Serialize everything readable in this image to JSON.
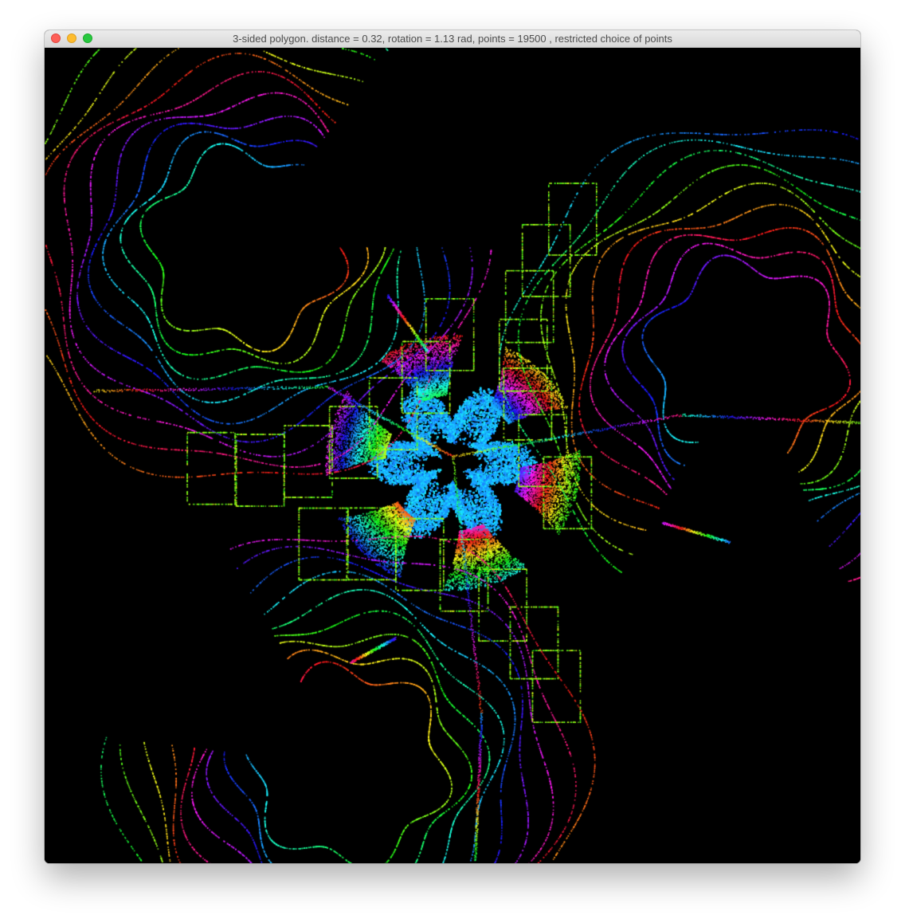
{
  "window": {
    "title": "3-sided polygon. distance = 0.32, rotation = 1.13 rad, points = 19500 , restricted choice of points",
    "controls": {
      "close_color": "#fe5f57",
      "minimize_color": "#febc2e",
      "zoom_color": "#28c840"
    }
  },
  "canvas": {
    "background": "#000000",
    "palette": "rainbow"
  }
}
